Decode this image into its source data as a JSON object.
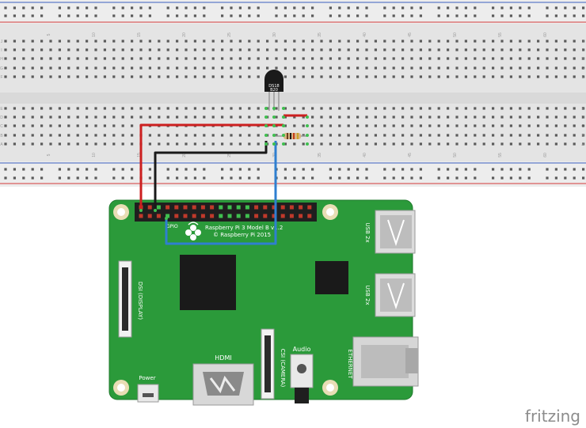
{
  "breadboard": {
    "column_numbers": [
      "5",
      "10",
      "15",
      "20",
      "25",
      "30",
      "35",
      "40",
      "45",
      "50",
      "55",
      "60"
    ],
    "row_letters_top": [
      "J",
      "I",
      "H",
      "G",
      "F"
    ],
    "row_letters_bottom": [
      "E",
      "D",
      "C",
      "B",
      "A"
    ]
  },
  "sensor": {
    "line1": "DS18",
    "line2": "B20"
  },
  "raspberry_pi": {
    "model_line1": "Raspberry Pi 3 Model B v1.2",
    "model_line2": "© Raspberry Pi 2015",
    "gpio_label": "GPIO",
    "dsi_label": "DSI (DISPLAY)",
    "csi_label": "CSI (CAMERA)",
    "hdmi_label": "HDMI",
    "audio_label": "Audio",
    "power_label": "Power",
    "usb1_label": "USB 2x",
    "usb2_label": "USB 2x",
    "ethernet_label": "ETHERNET"
  },
  "wires": [
    {
      "name": "power-wire",
      "color": "#cc1f1f"
    },
    {
      "name": "ground-wire",
      "color": "#1a1a1a"
    },
    {
      "name": "data-wire",
      "color": "#2f7fd0"
    }
  ],
  "colors": {
    "pcb": "#2b9a3a",
    "breadboard": "#e6e6e6",
    "rail_red": "#d23c3c",
    "rail_blue": "#3a5fc0",
    "header_pin": "#c0392b"
  },
  "watermark": "fritzing"
}
